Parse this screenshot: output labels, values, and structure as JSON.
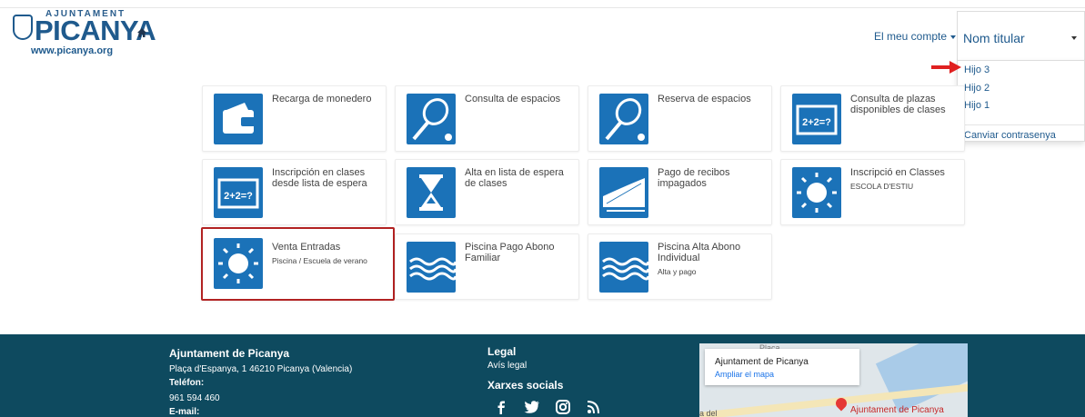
{
  "header": {
    "logo_top": "AJUNTAMENT",
    "logo_name": "PICANYA",
    "logo_url": "www.picanya.org",
    "account_label": "El meu compte",
    "holder_label": "Nom titular"
  },
  "dropdown": {
    "items": [
      "Hijo 3",
      "Hijo 2",
      "Hijo 1"
    ],
    "change_password": "Canviar contrasenya"
  },
  "tiles": [
    {
      "title": "Recarga de monedero",
      "subtitle": "",
      "icon": "wallet-icon"
    },
    {
      "title": "Consulta de espacios",
      "subtitle": "",
      "icon": "tennis-racket-icon"
    },
    {
      "title": "Reserva de espacios",
      "subtitle": "",
      "icon": "tennis-racket-icon"
    },
    {
      "title": "Consulta de plazas disponibles de clases",
      "subtitle": "",
      "icon": "blackboard-icon"
    },
    {
      "title": "Inscripción en clases desde lista de espera",
      "subtitle": "",
      "icon": "blackboard-icon"
    },
    {
      "title": "Alta en lista de espera de clases",
      "subtitle": "",
      "icon": "hourglass-icon"
    },
    {
      "title": "Pago de recibos impagados",
      "subtitle": "",
      "icon": "receipts-icon"
    },
    {
      "title": "Inscripció en Classes",
      "subtitle": "ESCOLA D'ESTIU",
      "icon": "sun-icon"
    },
    {
      "title": "Venta Entradas",
      "subtitle": "Piscina / Escuela de verano",
      "icon": "sun-icon"
    },
    {
      "title": "Piscina Pago Abono Familiar",
      "subtitle": "",
      "icon": "water-waves-icon"
    },
    {
      "title": "Piscina Alta Abono Individual",
      "subtitle": "Alta y pago",
      "icon": "water-waves-icon"
    }
  ],
  "footer": {
    "org_name": "Ajuntament de Picanya",
    "address": "Plaça d'Espanya, 1 46210 Picanya (Valencia)",
    "phone_label": "Teléfon:",
    "phone": "961 594 460",
    "email_label": "E-mail:",
    "legal_title": "Legal",
    "legal_link": "Avís legal",
    "social_title": "Xarxes socials",
    "social_icons": [
      "facebook-icon",
      "twitter-icon",
      "instagram-icon",
      "rss-icon"
    ]
  },
  "map": {
    "place_name": "Ajuntament de Picanya",
    "enlarge_link": "Ampliar el mapa",
    "pin_label": "Ajuntament de Picanya",
    "top_text": "Plaça",
    "side_text": "a del"
  },
  "colors": {
    "brand_blue": "#1b72b8",
    "footer_bg": "#0e4a5f",
    "selected_border": "#b22222",
    "arrow_red": "#e02020"
  }
}
